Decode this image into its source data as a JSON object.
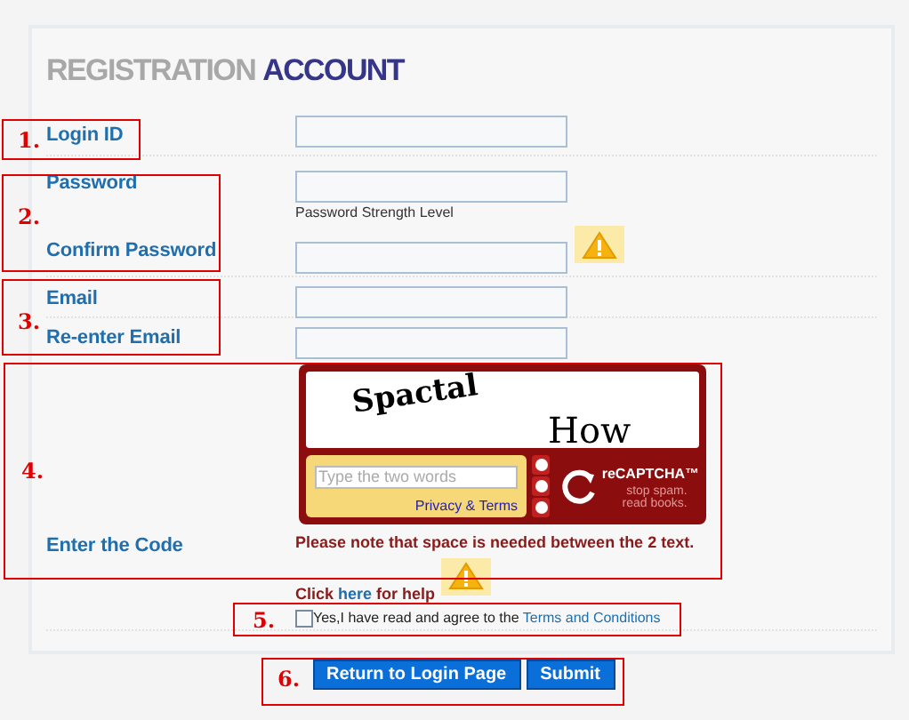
{
  "title": {
    "light": "REGISTRATION",
    "strong": "ACCOUNT"
  },
  "fields": [
    {
      "label": "Login ID"
    },
    {
      "label": "Password",
      "hint": "Password Strength Level"
    },
    {
      "label": "Confirm Password",
      "warning": true
    },
    {
      "label": "Email"
    },
    {
      "label": "Re-enter Email"
    }
  ],
  "captcha": {
    "label": "Enter the Code",
    "words": [
      "Spactal",
      "How"
    ],
    "placeholder": "Type the two words",
    "privacy_link": "Privacy & Terms",
    "logo": "reCAPTCHA™",
    "tagline": "stop spam. read books.",
    "note": "Please note that space is needed between the 2 text.",
    "warning": true
  },
  "help": {
    "before": "Click ",
    "link": "here",
    "after": " for help"
  },
  "agree": {
    "checked": false,
    "text": "Yes,I have read and agree to the ",
    "link": "Terms and Conditions"
  },
  "buttons": [
    "Return to Login Page",
    "Submit"
  ],
  "annotations": [
    {
      "label": "1."
    },
    {
      "label": "2."
    },
    {
      "label": "3."
    },
    {
      "label": "4."
    },
    {
      "label": "5."
    },
    {
      "label": "6."
    }
  ]
}
